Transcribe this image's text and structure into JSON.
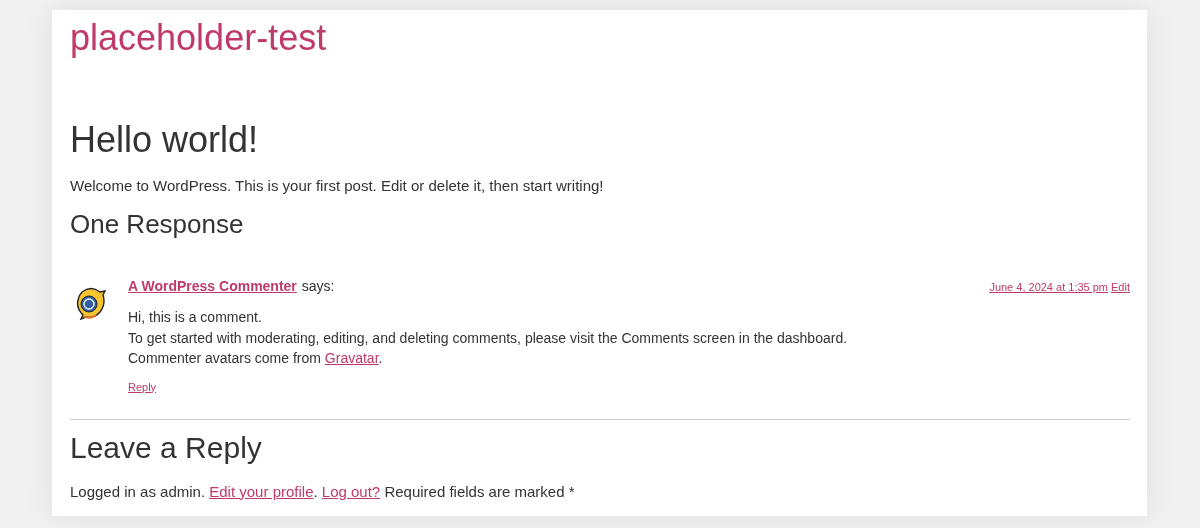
{
  "site_title": "placeholder-test",
  "post": {
    "title": "Hello world!",
    "body": "Welcome to WordPress. This is your first post. Edit or delete it, then start writing!"
  },
  "comments_title": "One Response",
  "comment": {
    "author": "A WordPress Commenter",
    "says": "says:",
    "date": "June 4, 2024 at 1:35 pm",
    "edit": "Edit",
    "lines": [
      [
        {
          "text": "Hi, this is a comment."
        }
      ],
      [
        {
          "text": "To get started with moderating, editing, and deleting comments, please visit the Comments screen in the dashboard."
        }
      ],
      [
        {
          "text": "Commenter avatars come from "
        },
        {
          "text": "Gravatar",
          "link": true
        },
        {
          "text": "."
        }
      ]
    ],
    "reply": "Reply"
  },
  "reply_title": "Leave a Reply",
  "logged_in": [
    {
      "text": "Logged in as admin. "
    },
    {
      "text": "Edit your profile",
      "link": true
    },
    {
      "text": ". "
    },
    {
      "text": "Log out?",
      "link": true
    },
    {
      "text": " Required fields are marked *"
    }
  ]
}
